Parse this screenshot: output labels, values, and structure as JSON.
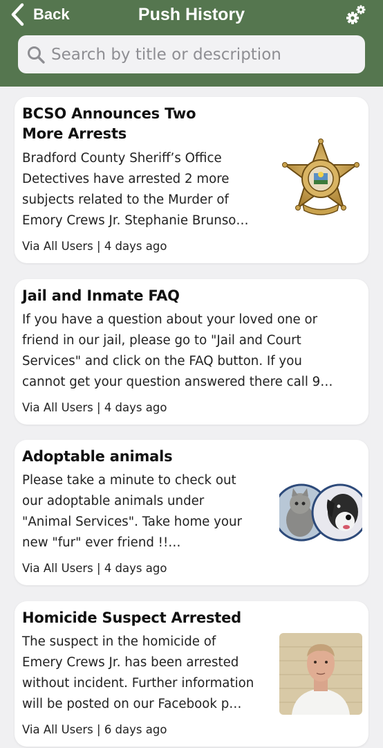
{
  "header": {
    "back_label": "Back",
    "title": "Push History",
    "header_color": "#55764f"
  },
  "search": {
    "placeholder": "Search by title or description"
  },
  "notifications": [
    {
      "title_lines": [
        "BCSO Announces Two",
        "More Arrests"
      ],
      "description_lines": [
        "Bradford County Sheriff’s Office",
        "Detectives have arrested 2 more",
        "subjects related to the Murder of",
        "Emory Crews Jr. Stephanie Brunso…"
      ],
      "meta": "Via All Users | 4 days ago",
      "thumbnail": "sheriff-badge"
    },
    {
      "title_lines": [
        "Jail and Inmate FAQ"
      ],
      "description_lines": [
        "If you have a question about your loved one or",
        "friend in our jail, please go to \"Jail and Court",
        "Services\" and click on the FAQ button. If you",
        "cannot get your question answered there call 9…"
      ],
      "meta": "Via All Users | 4 days ago",
      "thumbnail": null
    },
    {
      "title_lines": [
        "Adoptable animals"
      ],
      "description_lines": [
        "Please take a minute to check out",
        "our adoptable animals under",
        "\"Animal Services\". Take home your",
        "new \"fur\" ever friend !!…"
      ],
      "meta": "Via All Users | 4 days ago",
      "thumbnail": "cat-and-dog-photo"
    },
    {
      "title_lines": [
        "Homicide Suspect Arrested"
      ],
      "description_lines": [
        "The suspect in the homicide of",
        "Emery Crews Jr. has been arrested",
        "without incident. Further information",
        "will be posted on our Facebook p…"
      ],
      "meta": "Via All Users | 6 days ago",
      "thumbnail": "suspect-mugshot"
    }
  ]
}
